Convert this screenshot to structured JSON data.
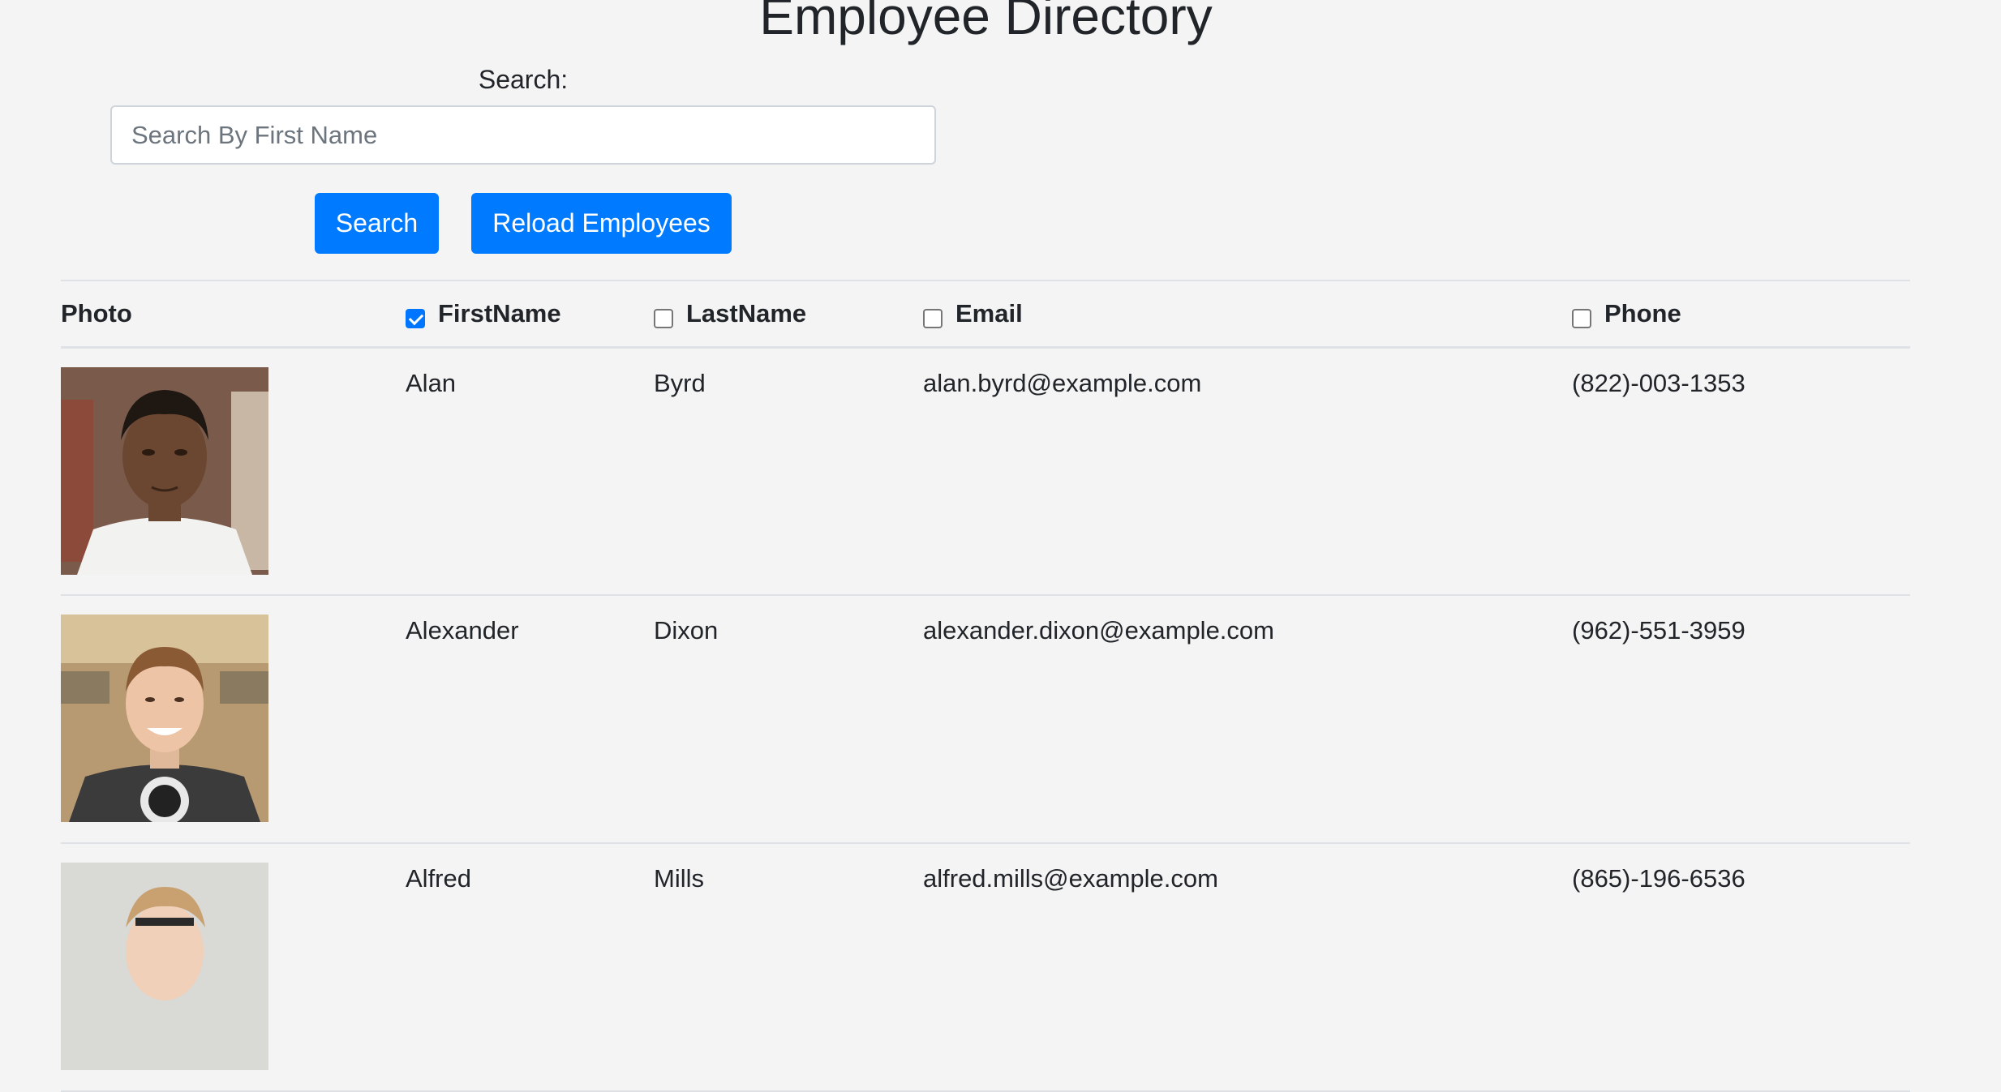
{
  "page": {
    "title": "Employee Directory"
  },
  "search": {
    "label": "Search:",
    "placeholder": "Search By First Name",
    "value": "",
    "search_button": "Search",
    "reload_button": "Reload Employees"
  },
  "table": {
    "headers": {
      "photo": "Photo",
      "first": "FirstName",
      "last": "LastName",
      "email": "Email",
      "phone": "Phone"
    },
    "sort_checks": {
      "first": true,
      "last": false,
      "email": false,
      "phone": false
    },
    "rows": [
      {
        "first": "Alan",
        "last": "Byrd",
        "email": "alan.byrd@example.com",
        "phone": "(822)-003-1353"
      },
      {
        "first": "Alexander",
        "last": "Dixon",
        "email": "alexander.dixon@example.com",
        "phone": "(962)-551-3959"
      },
      {
        "first": "Alfred",
        "last": "Mills",
        "email": "alfred.mills@example.com",
        "phone": "(865)-196-6536"
      }
    ]
  },
  "colors": {
    "accent": "#007bff",
    "background": "#f4f4f4",
    "border": "#dee2e6"
  }
}
